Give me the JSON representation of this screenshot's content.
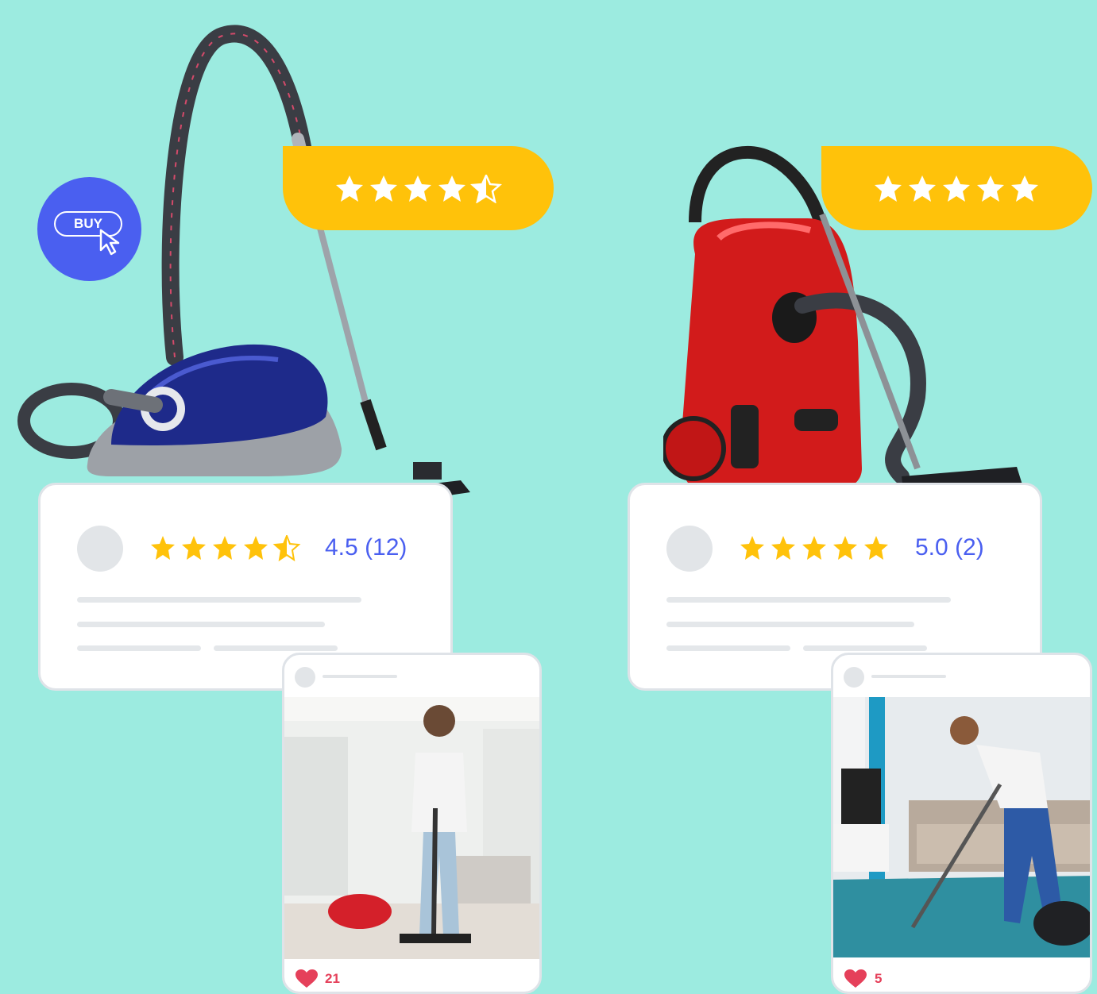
{
  "buy_button": {
    "label": "BUY"
  },
  "products": [
    {
      "name_hint": "blue-vacuum",
      "rating": {
        "value": "4.5",
        "count": "(12)",
        "stars": 4.5
      },
      "post": {
        "likes": "21"
      }
    },
    {
      "name_hint": "red-vacuum",
      "rating": {
        "value": "5.0",
        "count": "(2)",
        "stars": 5
      },
      "post": {
        "likes": "5"
      }
    }
  ],
  "colors": {
    "background": "#9cebe0",
    "accent": "#4a5ff0",
    "star": "#ffc20a",
    "heart": "#e5405a"
  }
}
